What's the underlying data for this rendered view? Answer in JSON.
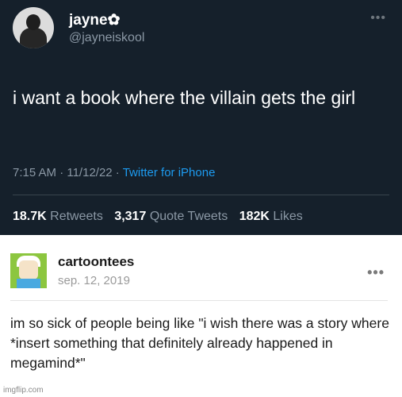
{
  "tweet": {
    "display_name": "jayne✿",
    "handle": "@jayneiskool",
    "more_icon": "•••",
    "text": "i want a book where the villain gets the girl",
    "timestamp": "7:15 AM · 11/12/22 · ",
    "source": "Twitter for iPhone",
    "retweets_count": "18.7K",
    "retweets_label": "Retweets",
    "quote_count": "3,317",
    "quote_label": "Quote Tweets",
    "likes_count": "182K",
    "likes_label": "Likes",
    "colors": {
      "background": "#15202b",
      "link": "#1d9bf0",
      "secondary": "#8b98a5"
    }
  },
  "post": {
    "username": "cartoontees",
    "date": "sep. 12, 2019",
    "more_icon": "•••",
    "text": "im so sick of people being like \"i wish there was a story where *insert something that definitely already happened in megamind*\"",
    "avatar_icon": "cartoon-character-avatar"
  },
  "watermark": "imgflip.com"
}
